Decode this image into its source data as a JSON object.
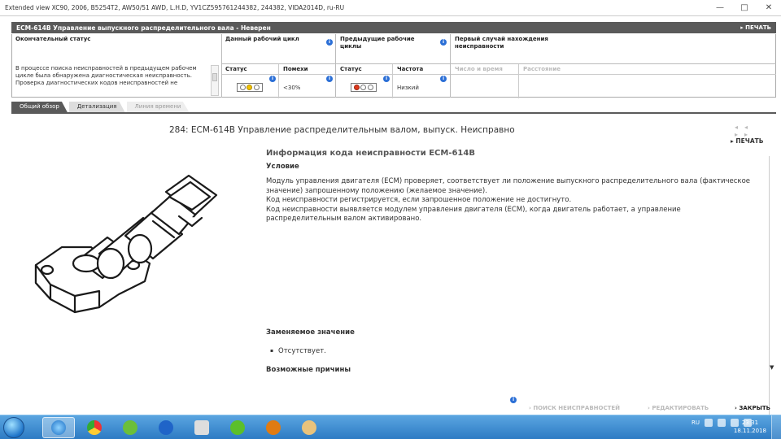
{
  "window": {
    "title": "Extended view    XC90, 2006, B5254T2, AW50/51 AWD, L.H.D, YV1CZ595761244382, 244382, VIDA2014D, ru-RU",
    "minimize": "—",
    "maximize": "□",
    "close": "✕"
  },
  "dtc_header": {
    "title": "ECM-614B Управление выпускного распределительного вала - Неверен",
    "print": "ПЕЧАТЬ"
  },
  "status_grid": {
    "final_status": "Окончательный статус",
    "current_cycle": "Данный рабочий цикл",
    "previous_cycles": "Предыдущие рабочие циклы",
    "first_occurrence": "Первый случай нахождения неисправности",
    "status": "Статус",
    "noise": "Помехи",
    "frequency": "Частота",
    "date_time": "Число и время",
    "distance": "Расстояние",
    "noise_value": "<30%",
    "frequency_value": "Низкий",
    "description": "В процессе поиска неисправностей в предыдущем рабочем цикле была обнаружена диагностическая неисправность. Проверка диагностических кодов неисправностей не",
    "lamp_colors": {
      "off": "#ffffff",
      "yellow": "#f2c200",
      "red": "#e03a1e"
    }
  },
  "tabs": [
    {
      "label": "Общий обзор"
    },
    {
      "label": "Детализация"
    },
    {
      "label": "Линия времени"
    }
  ],
  "main": {
    "title": "284: ECM-614B Управление распределительным валом, выпуск. Неисправно",
    "nav_arrows": "◂◂ ▸▸",
    "print": "ПЕЧАТЬ",
    "section_title": "Информация кода неисправности ECM-614B",
    "condition": "Условие",
    "body": [
      "Модуль управления двигателя (ECM) проверяет, соответствует ли положение выпускного распределительного вала (фактическое значение) запрошенному положению (желаемое значение).",
      "Код неисправности регистрируется, если запрошенное положение не достигнуто.",
      "Код неисправности выявляется модулем управления двигателя (ECM), когда двигатель работает, а управление распределительным валом активировано."
    ],
    "replaced_value": "Заменяемое значение",
    "bullet": "Отсутствует.",
    "possible_causes": "Возможные причины"
  },
  "bottom": {
    "search": "ПОИСК НЕИСПРАВНОСТЕЙ",
    "edit": "РЕДАКТИРОВАТЬ",
    "close": "ЗАКРЫТЬ"
  },
  "taskbar": {
    "lang": "RU",
    "time": "23:31",
    "date": "18.11.2018"
  }
}
